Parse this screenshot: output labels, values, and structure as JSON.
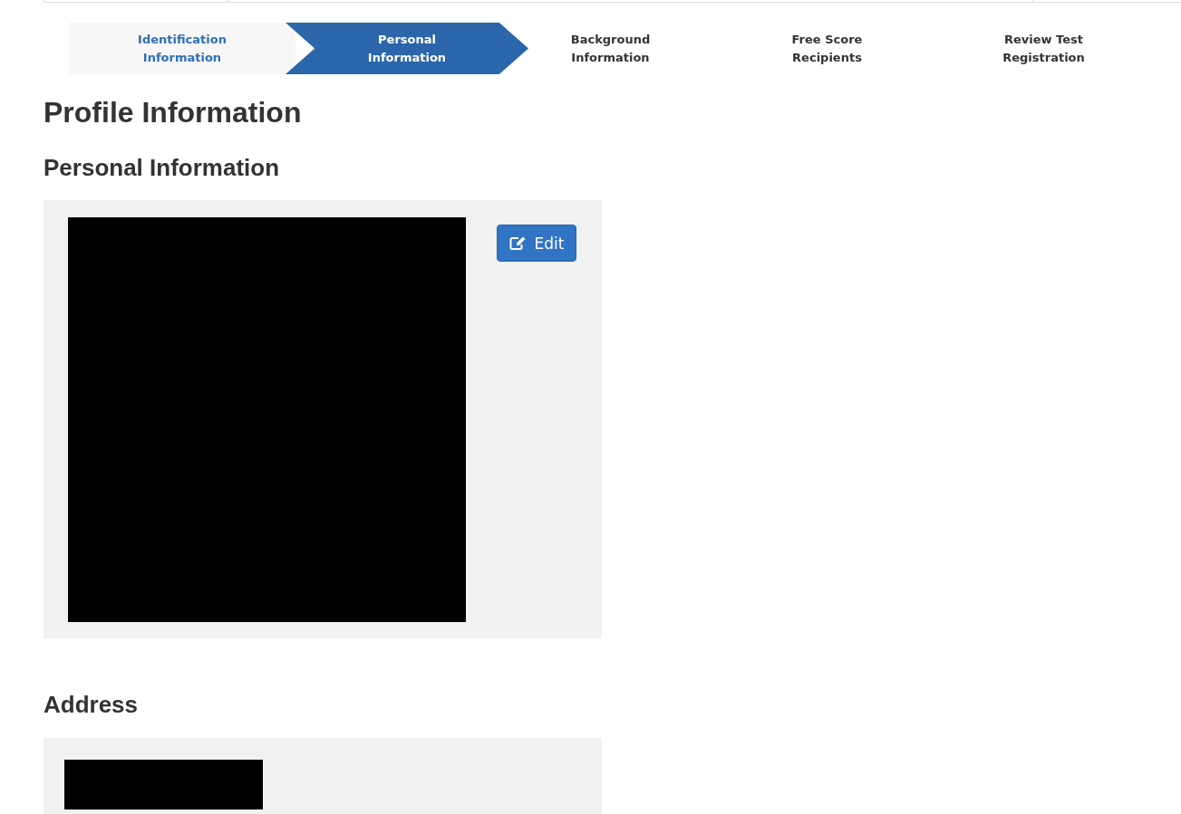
{
  "steps": [
    {
      "label": "Identification Information",
      "completed": true,
      "selected": false
    },
    {
      "label": "Personal Information",
      "completed": false,
      "selected": true
    },
    {
      "label": "Background Information",
      "completed": false,
      "selected": false
    },
    {
      "label": "Free Score Recipients",
      "completed": false,
      "selected": false
    },
    {
      "label": "Review Test Registration",
      "completed": false,
      "selected": false
    }
  ],
  "page_title": "Profile Information",
  "personal": {
    "heading": "Personal Information",
    "edit_button": "Edit"
  },
  "address": {
    "heading": "Address"
  }
}
